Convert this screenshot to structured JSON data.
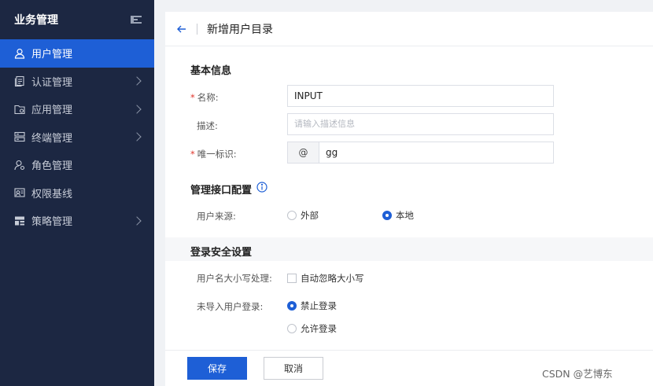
{
  "sidebar": {
    "title": "业务管理",
    "items": [
      {
        "label": "用户管理",
        "icon": "user-icon",
        "active": true,
        "has_children": false
      },
      {
        "label": "认证管理",
        "icon": "document-icon",
        "active": false,
        "has_children": true
      },
      {
        "label": "应用管理",
        "icon": "app-folder-icon",
        "active": false,
        "has_children": true
      },
      {
        "label": "终端管理",
        "icon": "terminal-icon",
        "active": false,
        "has_children": true
      },
      {
        "label": "角色管理",
        "icon": "role-icon",
        "active": false,
        "has_children": false
      },
      {
        "label": "权限基线",
        "icon": "permission-icon",
        "active": false,
        "has_children": false
      },
      {
        "label": "策略管理",
        "icon": "policy-icon",
        "active": false,
        "has_children": true
      }
    ]
  },
  "header": {
    "title": "新增用户目录"
  },
  "basic": {
    "title": "基本信息",
    "name_label": "名称:",
    "name_value": "INPUT",
    "desc_label": "描述:",
    "desc_placeholder": "请输入描述信息",
    "id_label": "唯一标识:",
    "id_prefix": "@",
    "id_value": "gg"
  },
  "interface": {
    "title": "管理接口配置",
    "source_label": "用户来源:",
    "options": [
      "外部",
      "本地"
    ],
    "selected": "本地"
  },
  "security": {
    "title": "登录安全设置",
    "case_label": "用户名大小写处理:",
    "case_option": "自动忽略大小写",
    "case_checked": false,
    "import_label": "未导入用户登录:",
    "import_options": [
      "禁止登录",
      "允许登录"
    ],
    "import_selected": "禁止登录"
  },
  "footer": {
    "save_label": "保存",
    "cancel_label": "取消"
  },
  "watermark": "CSDN @艺博东",
  "colors": {
    "sidebar_bg": "#1c2742",
    "accent": "#1e5fd6",
    "required": "#e0362c"
  }
}
